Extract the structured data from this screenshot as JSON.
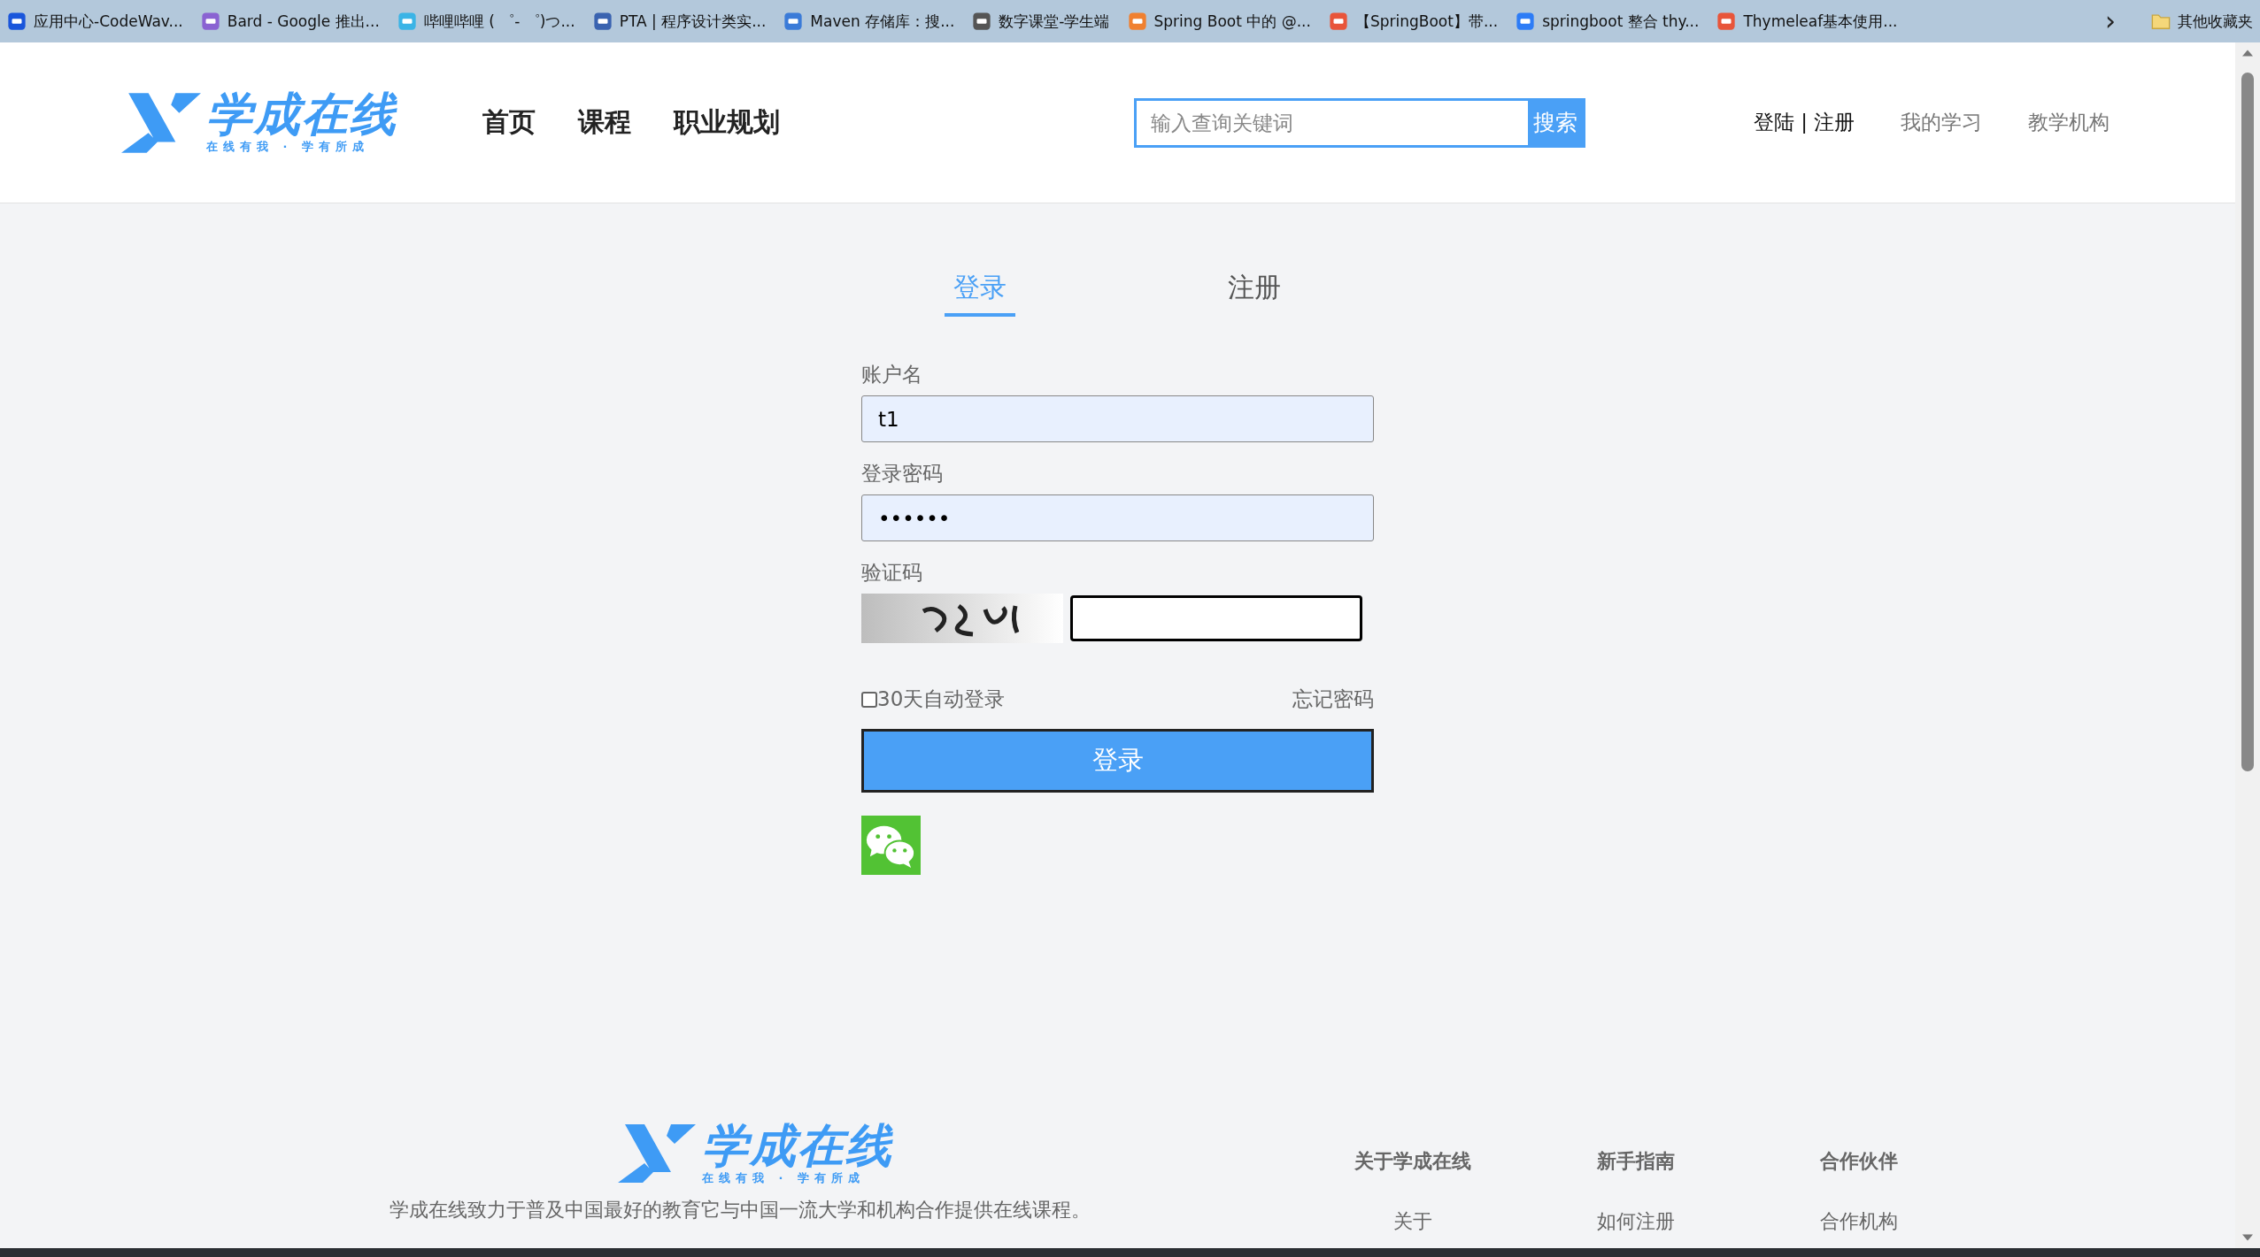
{
  "bookmarks": [
    {
      "label": "应用中心-CodeWav..."
    },
    {
      "label": "Bard - Google 推出..."
    },
    {
      "label": "哔哩哔哩 ( ゜- ゜)つ..."
    },
    {
      "label": "PTA | 程序设计类实..."
    },
    {
      "label": "Maven 存储库：搜..."
    },
    {
      "label": "数字课堂-学生端"
    },
    {
      "label": "Spring Boot 中的 @..."
    },
    {
      "label": "【SpringBoot】带..."
    },
    {
      "label": "springboot 整合 thy..."
    },
    {
      "label": "Thymeleaf基本使用..."
    }
  ],
  "bookmarks_more": "›",
  "bookmarks_folder": "其他收藏夹",
  "header": {
    "logo": {
      "title": "学成在线",
      "slogan": "在线有我 · 学有所成"
    },
    "nav": [
      {
        "label": "首页"
      },
      {
        "label": "课程"
      },
      {
        "label": "职业规划"
      }
    ],
    "search": {
      "placeholder": "输入查询关键词",
      "button": "搜索"
    },
    "account_link": "登陆 | 注册",
    "links": [
      {
        "label": "我的学习"
      },
      {
        "label": "教学机构"
      }
    ]
  },
  "tabs": [
    {
      "label": "登录",
      "selected": true
    },
    {
      "label": "注册",
      "selected": false
    }
  ],
  "form": {
    "username_label": "账户名",
    "username": "t1",
    "password_label": "登录密码",
    "password": "••••••",
    "captcha_label": "验证码",
    "remember": {
      "label": "30天自动登录",
      "checked": false
    },
    "forgot": "忘记密码",
    "submit": "登录"
  },
  "footer": {
    "logo": {
      "title": "学成在线",
      "slogan": "在线有我 · 学有所成"
    },
    "description": "学成在线致力于普及中国最好的教育它与中国一流大学和机构合作提供在线课程。",
    "columns": [
      {
        "heading": "关于学成在线",
        "items": [
          "关于"
        ]
      },
      {
        "heading": "新手指南",
        "items": [
          "如何注册"
        ]
      },
      {
        "heading": "合作伙伴",
        "items": [
          "合作机构"
        ]
      }
    ]
  }
}
